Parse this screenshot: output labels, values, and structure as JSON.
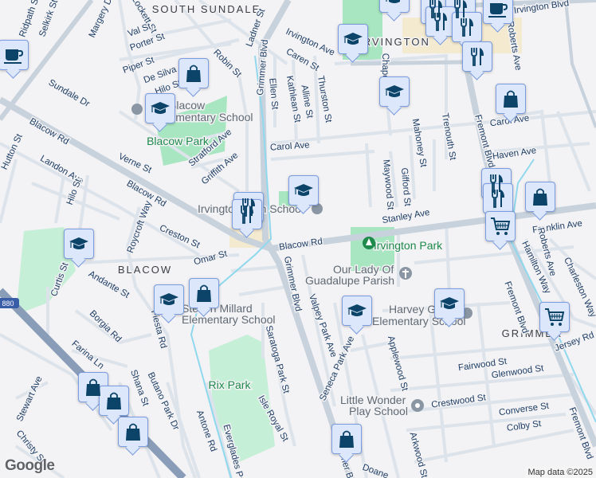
{
  "neighborhoods": [
    "SOUTH SUNDALE",
    "IRVINGTON",
    "BLACOW",
    "GRIMMER"
  ],
  "parks": [
    "Blacow Park",
    "Irvington Park",
    "Rix Park"
  ],
  "pois": {
    "blacow_school": [
      "Blacow",
      "Elementary School"
    ],
    "irvington_high": [
      "Irvington High School"
    ],
    "guadalupe": [
      "Our Lady Of",
      "Guadalupe Parish"
    ],
    "harvey_green": [
      "Harvey Green",
      "Elementary School"
    ],
    "millard": [
      "Steven Millard",
      "Elementary School"
    ],
    "little_wonder": [
      "Little Wonder",
      "Play School"
    ]
  },
  "streets": [
    "Ridpath St",
    "Selkirk St",
    "Margery Dr",
    "Lockett St",
    "Val St",
    "Porter St",
    "Piper St",
    "De Silva",
    "Hilo St",
    "Robin St",
    "Ladner St",
    "Grimmer Blvd",
    "Irvington Ave",
    "Caren St",
    "Ellen St",
    "Kathlean St",
    "Alline St",
    "Thurston St",
    "Chapel",
    "Mahoney St",
    "Trenouth St",
    "Fremont Blvd",
    "Roberts Ave",
    "Irvington Blvd",
    "Carol Ave",
    "Carol Ave",
    "Haven Ave",
    "Maywood St",
    "Gifford St",
    "Stanley Ave",
    "Franklin Ave",
    "Sundale Dr",
    "Blacow Rd",
    "Blacow Rd",
    "Blacow Rd",
    "Hutton St",
    "Landon Ave",
    "Hilo St",
    "Verne St",
    "Stratford Ave",
    "Griffith Ave",
    "Roycroft Way",
    "Creston St",
    "Omar St",
    "Andante St",
    "Curtis St",
    "Borgia Rd",
    "Fiesta Rd",
    "Farina Ln",
    "Shana St",
    "Butano Park Dr",
    "Stewart Ave",
    "Christy St",
    "Antone Rd",
    "Everglades Pa",
    "Saratoga Park St",
    "Isle Royal St",
    "Grimmer Blvd",
    "Grimmer Blvd",
    "Valpey Park Ave",
    "Seneca Park Ave",
    "Applewood St",
    "Arkwood St",
    "Doane",
    "Fairwood St",
    "Glenwood St",
    "Crestwood St",
    "Converse St",
    "Colby St",
    "Fremont Blvd",
    "Fremont Blvd",
    "Hamilton Way",
    "Roberts Ave",
    "Charleston Way",
    "Jersey Rd",
    "Omar St"
  ],
  "highway_shield": "880",
  "footer": {
    "logo": "Google",
    "attribution": "Map data ©2025"
  },
  "colors": {
    "background": "#f3f2f4",
    "road": "#d5dde6",
    "major_road": "#c8d2dc",
    "freeway": "#8a9db8",
    "park": "#a8e6c1",
    "commercial": "#f4ead0",
    "water": "#8fd8ee",
    "marker_fill": "#dde7fb",
    "marker_icon": "#0b4468"
  }
}
